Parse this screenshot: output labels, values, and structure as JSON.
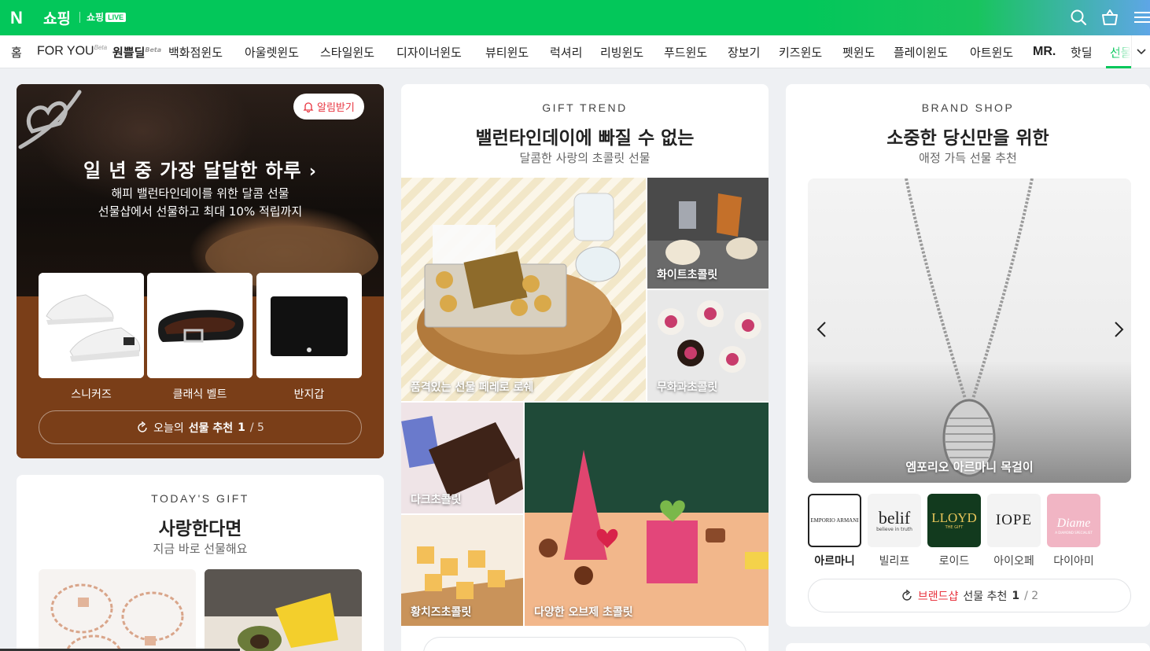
{
  "header": {
    "logo": "N",
    "brand": "쇼핑",
    "live_prefix": "쇼핑",
    "live_badge": "LIVE"
  },
  "nav": {
    "items": [
      {
        "label": "홈"
      },
      {
        "label": "FOR YOU",
        "sup": "Beta"
      },
      {
        "label": "원쁠딜",
        "sup": "Beta"
      },
      {
        "label": "백화점윈도"
      },
      {
        "label": "아울렛윈도"
      },
      {
        "label": "스타일윈도"
      },
      {
        "label": "디자이너윈도"
      },
      {
        "label": "뷰티윈도"
      },
      {
        "label": "럭셔리"
      },
      {
        "label": "리빙윈도"
      },
      {
        "label": "푸드윈도"
      },
      {
        "label": "장보기"
      },
      {
        "label": "키즈윈도"
      },
      {
        "label": "펫윈도"
      },
      {
        "label": "플레이윈도"
      },
      {
        "label": "아트윈도"
      },
      {
        "label": "MR."
      },
      {
        "label": "핫딜"
      },
      {
        "label": "선물"
      }
    ]
  },
  "hero": {
    "alarm": "알림받기",
    "title": "일 년 중 가장 달달한 하루",
    "sub1": "해피 밸런타인데이를 위한 달콤 선물",
    "sub2": "선물샵에서 선물하고 최대 10% 적립까지",
    "products": [
      {
        "label": "스니커즈"
      },
      {
        "label": "클래식 벨트"
      },
      {
        "label": "반지갑"
      }
    ],
    "btn_prefix": "오늘의",
    "btn_bold": "선물 추천",
    "btn_page": "1",
    "btn_total": "/ 5"
  },
  "today": {
    "eyebrow": "TODAY'S GIFT",
    "title": "사랑한다면",
    "sub": "지금 바로 선물해요"
  },
  "trend": {
    "eyebrow": "GIFT TREND",
    "title": "밸런타인데이에 빠질 수 없는",
    "sub": "달콤한 사랑의 초콜릿 선물",
    "tiles": [
      {
        "label": "품격있는 선물 페레로 로쉐"
      },
      {
        "label": "화이트초콜릿"
      },
      {
        "label": "무화과초콜릿"
      },
      {
        "label": "다크초콜릿"
      },
      {
        "label": "다양한 오브제 초콜릿"
      },
      {
        "label": "황치즈초콜릿"
      }
    ]
  },
  "brandshop": {
    "eyebrow": "BRAND SHOP",
    "title": "소중한 당신만을 위한",
    "sub": "애정 가득 선물 추천",
    "product_label": "엠포리오 아르마니 목걸이",
    "brands": [
      {
        "name": "아르마니",
        "logo": "EMPORIO ARMANI",
        "selected": true
      },
      {
        "name": "빌리프",
        "logo": "belif",
        "tagline": "believe in truth"
      },
      {
        "name": "로이드",
        "logo": "LLOYD",
        "tagline": "THE GIFT"
      },
      {
        "name": "아이오페",
        "logo": "IOPE"
      },
      {
        "name": "다이아미",
        "logo": "Diame",
        "tagline": "A DIAMOND SPECIALIST"
      }
    ],
    "btn_accent": "브랜드샵",
    "btn_bold": "선물 추천",
    "btn_page": "1",
    "btn_total": "/ 2"
  },
  "colors": {
    "naver_green": "#03c75a",
    "hero_brown": "#7a3e18",
    "alert_red": "#e8343f"
  }
}
